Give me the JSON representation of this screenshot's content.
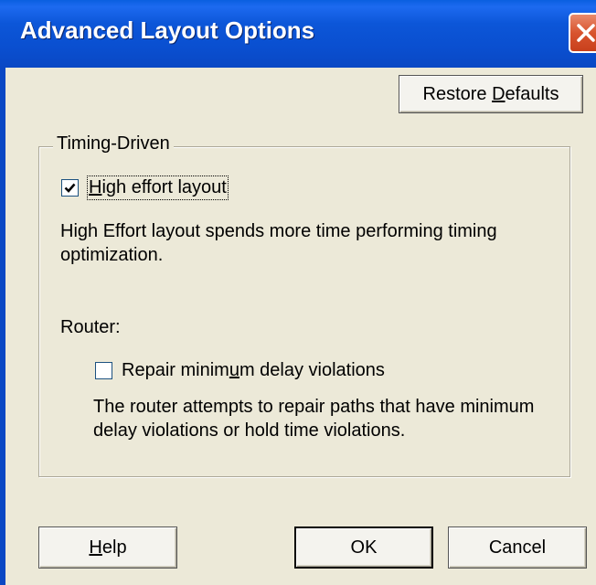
{
  "window": {
    "title": "Advanced Layout Options"
  },
  "buttons": {
    "restore_defaults": {
      "before": "Restore ",
      "mnemonic": "D",
      "after": "efaults"
    },
    "help": {
      "before": "",
      "mnemonic": "H",
      "after": "elp"
    },
    "ok": "OK",
    "cancel": "Cancel"
  },
  "timing_group": {
    "label": "Timing-Driven",
    "high_effort": {
      "checked": true,
      "before": "",
      "mnemonic": "H",
      "after": "igh effort layout",
      "description_line1": "High Effort layout spends more time performing timing",
      "description_line2": "optimization."
    },
    "router": {
      "label": "Router:",
      "repair": {
        "checked": false,
        "before": "Repair minim",
        "mnemonic": "u",
        "after": "m delay violations",
        "description_line1": "The router attempts to repair paths that have minimum",
        "description_line2": "delay violations or hold time violations."
      }
    }
  },
  "icons": {
    "close": "close-icon",
    "checkmark": "checkmark-icon"
  }
}
